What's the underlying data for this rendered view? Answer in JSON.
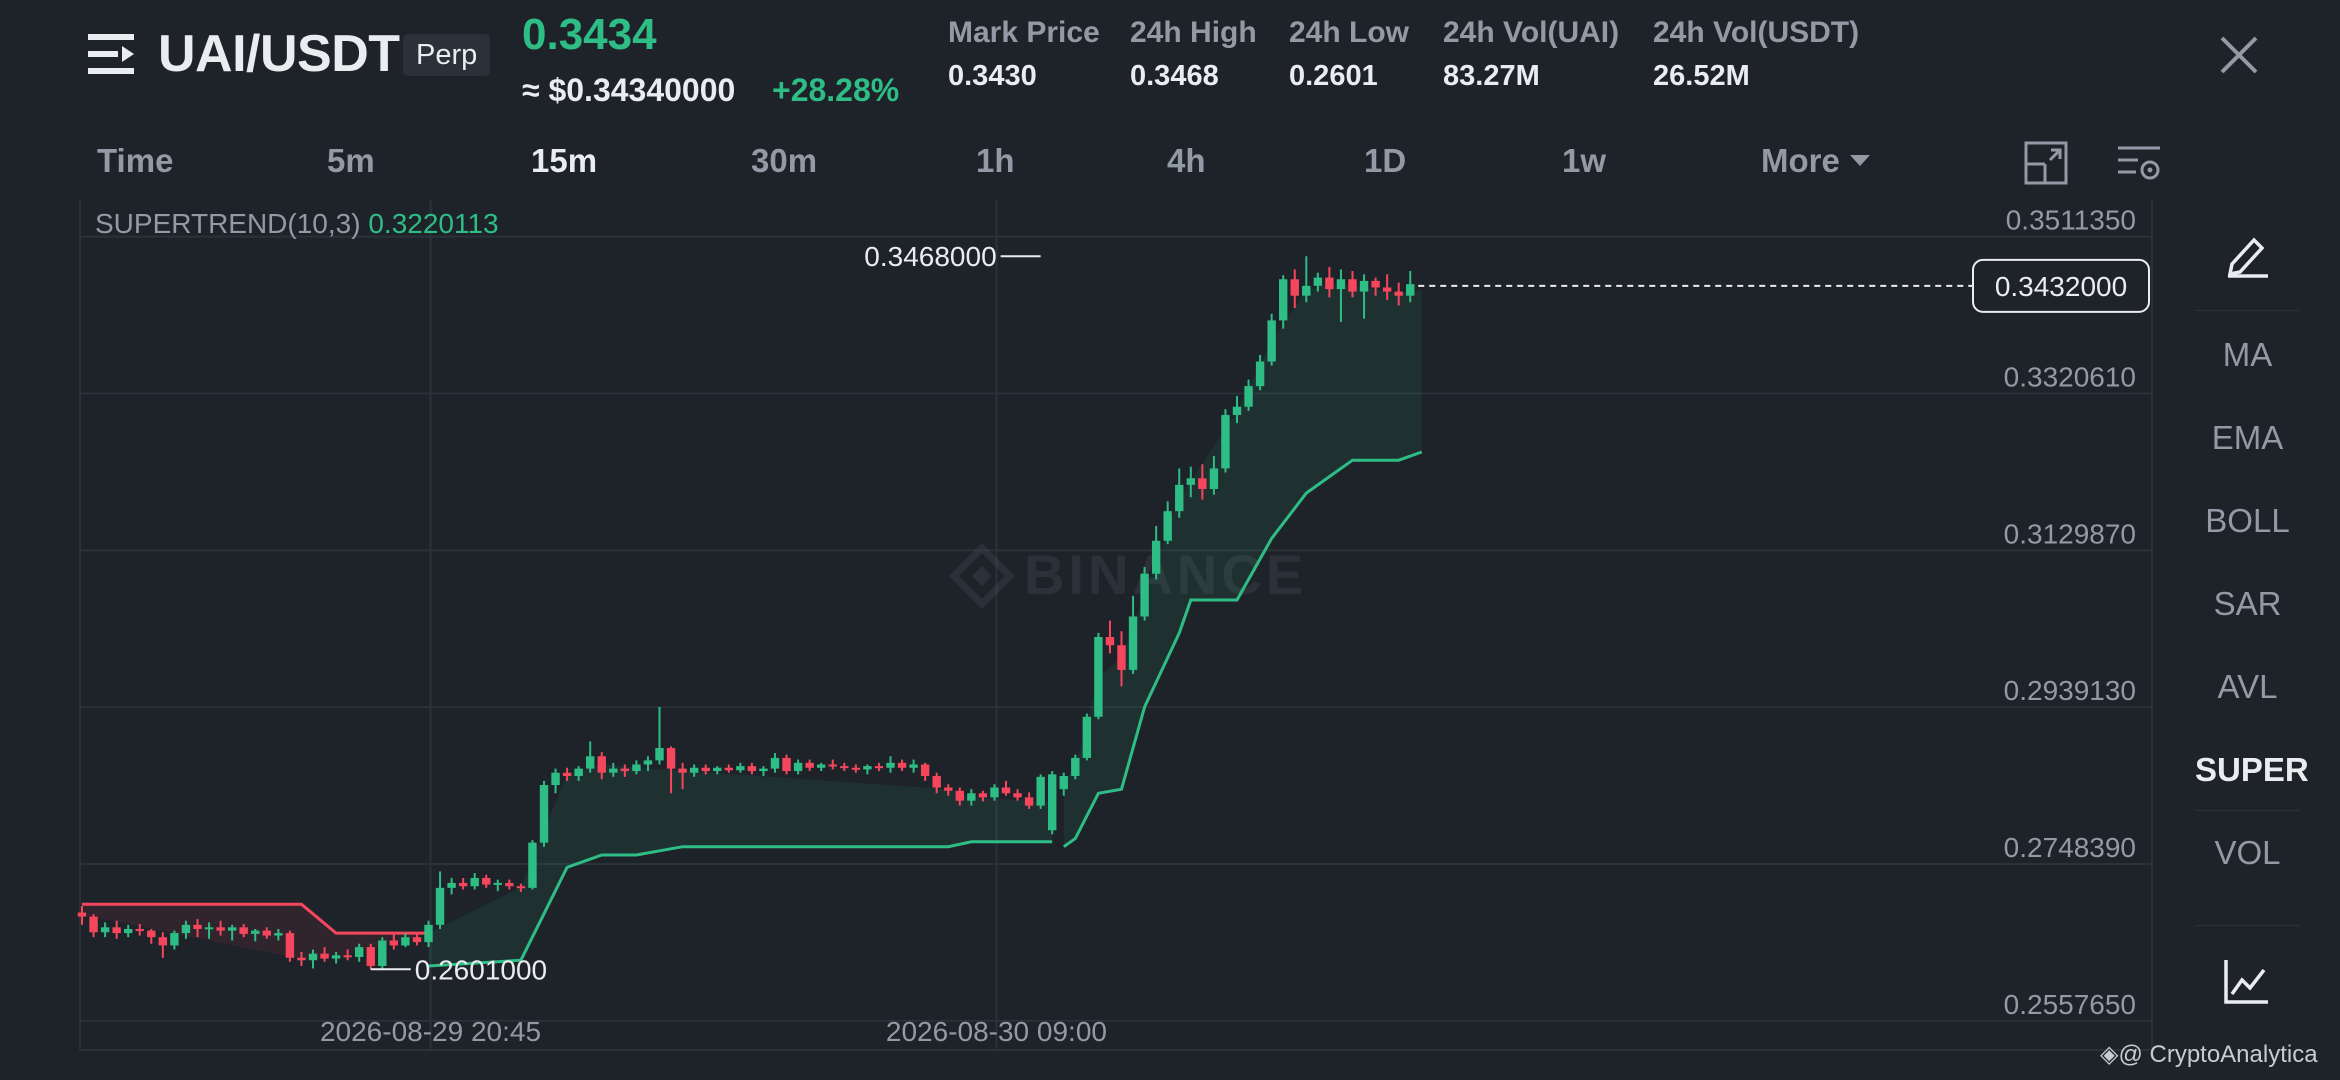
{
  "header": {
    "symbol": "UAI/USDT",
    "contract_type": "Perp",
    "last_price": "0.3434",
    "usd_price": "≈ $0.34340000",
    "change_pct": "+28.28%",
    "stats": [
      {
        "label": "Mark Price",
        "value": "0.3430"
      },
      {
        "label": "24h High",
        "value": "0.3468"
      },
      {
        "label": "24h Low",
        "value": "0.2601"
      },
      {
        "label": "24h Vol(UAI)",
        "value": "83.27M"
      },
      {
        "label": "24h Vol(USDT)",
        "value": "26.52M"
      }
    ]
  },
  "intervals": [
    {
      "label": "Time",
      "active": false
    },
    {
      "label": "5m",
      "active": false
    },
    {
      "label": "15m",
      "active": true
    },
    {
      "label": "30m",
      "active": false
    },
    {
      "label": "1h",
      "active": false
    },
    {
      "label": "4h",
      "active": false
    },
    {
      "label": "1D",
      "active": false
    },
    {
      "label": "1w",
      "active": false
    },
    {
      "label": "More",
      "active": false
    }
  ],
  "indicators": [
    {
      "label": "MA",
      "active": false
    },
    {
      "label": "EMA",
      "active": false
    },
    {
      "label": "BOLL",
      "active": false
    },
    {
      "label": "SAR",
      "active": false
    },
    {
      "label": "AVL",
      "active": false
    },
    {
      "label": "SUPER",
      "active": true
    },
    {
      "label": "VOL",
      "active": false
    }
  ],
  "icons": {
    "menu": "menu-icon",
    "close": "close-icon",
    "draw": "pencil-icon",
    "fullscreen": "fullscreen-icon",
    "settings": "chart-settings-icon",
    "chart_type": "line-chart-icon"
  },
  "colors": {
    "bg": "#1e2329",
    "up": "#2ebd85",
    "down": "#f6465d",
    "grid": "#2b3139",
    "text_muted": "#929aa5"
  },
  "supertrend": {
    "label": "SUPERTREND(10,3)",
    "value": "0.3220113"
  },
  "watermark": "◈@ CryptoAnalytica",
  "chart_data": {
    "type": "candlestick",
    "y_ticks": [
      "0.3511350",
      "0.3320610",
      "0.3129870",
      "0.2939130",
      "0.2748390",
      "0.2557650"
    ],
    "ylim": [
      0.2515,
      0.3585
    ],
    "x_ticks": [
      {
        "label": "2026-08-29 20:45",
        "index": 30
      },
      {
        "label": "2026-08-30 09:00",
        "index": 79
      }
    ],
    "current_price_label": "0.3432000",
    "current_price": 0.3432,
    "high_marker": {
      "label": "0.3468000",
      "index": 83,
      "value": 0.3468
    },
    "low_marker": {
      "label": "0.2601000",
      "index": 25,
      "value": 0.2601
    },
    "candles": [
      [
        0.267,
        0.2678,
        0.2655,
        0.2665
      ],
      [
        0.2665,
        0.2668,
        0.264,
        0.2646
      ],
      [
        0.2646,
        0.2658,
        0.264,
        0.2652
      ],
      [
        0.2652,
        0.266,
        0.2638,
        0.2645
      ],
      [
        0.2645,
        0.2655,
        0.264,
        0.265
      ],
      [
        0.265,
        0.2656,
        0.2642,
        0.2648
      ],
      [
        0.2648,
        0.265,
        0.2632,
        0.264
      ],
      [
        0.264,
        0.2646,
        0.2615,
        0.263
      ],
      [
        0.263,
        0.2648,
        0.2625,
        0.2645
      ],
      [
        0.2645,
        0.266,
        0.2638,
        0.2655
      ],
      [
        0.2655,
        0.2662,
        0.264,
        0.265
      ],
      [
        0.265,
        0.2658,
        0.2638,
        0.2652
      ],
      [
        0.2652,
        0.266,
        0.2642,
        0.2648
      ],
      [
        0.2648,
        0.2655,
        0.2636,
        0.2652
      ],
      [
        0.2652,
        0.2656,
        0.264,
        0.2644
      ],
      [
        0.2644,
        0.265,
        0.2635,
        0.2648
      ],
      [
        0.2648,
        0.2652,
        0.2638,
        0.2642
      ],
      [
        0.2642,
        0.265,
        0.2636,
        0.2645
      ],
      [
        0.2645,
        0.2648,
        0.261,
        0.2615
      ],
      [
        0.2615,
        0.2622,
        0.2605,
        0.2612
      ],
      [
        0.2612,
        0.2625,
        0.2602,
        0.262
      ],
      [
        0.262,
        0.2628,
        0.261,
        0.2614
      ],
      [
        0.2614,
        0.2622,
        0.2608,
        0.2618
      ],
      [
        0.2618,
        0.2625,
        0.2612,
        0.2616
      ],
      [
        0.2616,
        0.2632,
        0.261,
        0.2628
      ],
      [
        0.2628,
        0.2632,
        0.2601,
        0.2605
      ],
      [
        0.2605,
        0.264,
        0.2602,
        0.2636
      ],
      [
        0.2636,
        0.2645,
        0.2625,
        0.263
      ],
      [
        0.263,
        0.2645,
        0.2628,
        0.264
      ],
      [
        0.264,
        0.2646,
        0.263,
        0.2634
      ],
      [
        0.2634,
        0.266,
        0.2628,
        0.2655
      ],
      [
        0.2655,
        0.272,
        0.265,
        0.27
      ],
      [
        0.27,
        0.2712,
        0.2692,
        0.2706
      ],
      [
        0.2706,
        0.2712,
        0.2698,
        0.2702
      ],
      [
        0.2702,
        0.2718,
        0.2698,
        0.2712
      ],
      [
        0.2712,
        0.2716,
        0.27,
        0.2704
      ],
      [
        0.2704,
        0.271,
        0.2696,
        0.2706
      ],
      [
        0.2706,
        0.271,
        0.2698,
        0.2702
      ],
      [
        0.2702,
        0.2705,
        0.2695,
        0.27
      ],
      [
        0.27,
        0.2758,
        0.2698,
        0.2755
      ],
      [
        0.2755,
        0.283,
        0.275,
        0.2825
      ],
      [
        0.2825,
        0.2845,
        0.2815,
        0.284
      ],
      [
        0.284,
        0.2846,
        0.283,
        0.2836
      ],
      [
        0.2836,
        0.2848,
        0.283,
        0.2845
      ],
      [
        0.2845,
        0.2878,
        0.284,
        0.286
      ],
      [
        0.286,
        0.2865,
        0.2832,
        0.284
      ],
      [
        0.284,
        0.2852,
        0.2835,
        0.2845
      ],
      [
        0.2845,
        0.285,
        0.2835,
        0.2842
      ],
      [
        0.2842,
        0.2855,
        0.2838,
        0.285
      ],
      [
        0.285,
        0.286,
        0.2842,
        0.2855
      ],
      [
        0.2855,
        0.292,
        0.285,
        0.287
      ],
      [
        0.287,
        0.2872,
        0.2815,
        0.2845
      ],
      [
        0.2845,
        0.2852,
        0.282,
        0.284
      ],
      [
        0.284,
        0.285,
        0.2835,
        0.2846
      ],
      [
        0.2846,
        0.285,
        0.2838,
        0.2842
      ],
      [
        0.2842,
        0.2848,
        0.2838,
        0.2846
      ],
      [
        0.2846,
        0.285,
        0.284,
        0.2843
      ],
      [
        0.2843,
        0.2852,
        0.284,
        0.2848
      ],
      [
        0.2848,
        0.2852,
        0.2838,
        0.2842
      ],
      [
        0.2842,
        0.2848,
        0.2836,
        0.2845
      ],
      [
        0.2845,
        0.2864,
        0.284,
        0.2858
      ],
      [
        0.2858,
        0.2862,
        0.2838,
        0.2842
      ],
      [
        0.2842,
        0.2856,
        0.2838,
        0.2852
      ],
      [
        0.2852,
        0.2856,
        0.2842,
        0.2846
      ],
      [
        0.2846,
        0.2852,
        0.2842,
        0.285
      ],
      [
        0.285,
        0.2856,
        0.2844,
        0.2848
      ],
      [
        0.2848,
        0.2852,
        0.2842,
        0.2846
      ],
      [
        0.2846,
        0.285,
        0.284,
        0.2844
      ],
      [
        0.2844,
        0.285,
        0.2838,
        0.2848
      ],
      [
        0.2848,
        0.2852,
        0.2842,
        0.2846
      ],
      [
        0.2846,
        0.286,
        0.284,
        0.2852
      ],
      [
        0.2852,
        0.2856,
        0.2842,
        0.2846
      ],
      [
        0.2846,
        0.2856,
        0.284,
        0.285
      ],
      [
        0.285,
        0.2852,
        0.283,
        0.2836
      ],
      [
        0.2836,
        0.284,
        0.2815,
        0.2822
      ],
      [
        0.2822,
        0.2826,
        0.2812,
        0.2818
      ],
      [
        0.2818,
        0.2822,
        0.28,
        0.2806
      ],
      [
        0.2806,
        0.282,
        0.28,
        0.2815
      ],
      [
        0.2815,
        0.2818,
        0.2805,
        0.281
      ],
      [
        0.281,
        0.2826,
        0.2806,
        0.2822
      ],
      [
        0.2822,
        0.283,
        0.2812,
        0.2815
      ],
      [
        0.2815,
        0.282,
        0.2806,
        0.281
      ],
      [
        0.281,
        0.2816,
        0.2796,
        0.28
      ],
      [
        0.28,
        0.2838,
        0.2796,
        0.2835
      ]
    ],
    "candles_tail": [
      [
        0.277,
        0.2842,
        0.2765,
        0.2838
      ],
      [
        0.282,
        0.284,
        0.2812,
        0.2836
      ],
      [
        0.2836,
        0.2862,
        0.2832,
        0.2858
      ],
      [
        0.2858,
        0.2912,
        0.2855,
        0.2908
      ],
      [
        0.2908,
        0.301,
        0.2905,
        0.3005
      ],
      [
        0.3005,
        0.3025,
        0.2985,
        0.2995
      ],
      [
        0.2995,
        0.3012,
        0.2945,
        0.2965
      ],
      [
        0.2965,
        0.3055,
        0.296,
        0.303
      ],
      [
        0.303,
        0.309,
        0.3025,
        0.3082
      ],
      [
        0.3082,
        0.314,
        0.3075,
        0.3122
      ],
      [
        0.3122,
        0.317,
        0.3118,
        0.3158
      ],
      [
        0.3158,
        0.321,
        0.315,
        0.319
      ],
      [
        0.319,
        0.3212,
        0.3175,
        0.3198
      ],
      [
        0.3198,
        0.3215,
        0.3172,
        0.3185
      ],
      [
        0.3185,
        0.3225,
        0.3178,
        0.321
      ],
      [
        0.321,
        0.3282,
        0.3205,
        0.3275
      ],
      [
        0.3275,
        0.3298,
        0.3265,
        0.3285
      ],
      [
        0.3285,
        0.3318,
        0.328,
        0.331
      ],
      [
        0.331,
        0.3348,
        0.3305,
        0.334
      ],
      [
        0.334,
        0.3398,
        0.3335,
        0.339
      ],
      [
        0.339,
        0.3445,
        0.338,
        0.344
      ],
      [
        0.344,
        0.3452,
        0.3405,
        0.342
      ],
      [
        0.342,
        0.3468,
        0.3412,
        0.3432
      ],
      [
        0.3432,
        0.3448,
        0.3425,
        0.3442
      ],
      [
        0.3442,
        0.3455,
        0.3418,
        0.3428
      ],
      [
        0.3428,
        0.3452,
        0.3388,
        0.344
      ],
      [
        0.344,
        0.345,
        0.3418,
        0.3425
      ],
      [
        0.3425,
        0.3446,
        0.3392,
        0.3438
      ],
      [
        0.3438,
        0.3442,
        0.342,
        0.343
      ],
      [
        0.343,
        0.3446,
        0.3415,
        0.3425
      ],
      [
        0.3425,
        0.3436,
        0.3408,
        0.342
      ],
      [
        0.342,
        0.345,
        0.3412,
        0.3434
      ]
    ],
    "supertrend_down": [
      [
        0,
        0.268
      ],
      [
        19,
        0.268
      ],
      [
        22,
        0.2645
      ],
      [
        30,
        0.2645
      ]
    ],
    "supertrend_up": [
      [
        30,
        0.2605
      ],
      [
        38,
        0.2612
      ],
      [
        42,
        0.2725
      ],
      [
        45,
        0.274
      ],
      [
        48,
        0.274
      ],
      [
        52,
        0.275
      ],
      [
        75,
        0.275
      ],
      [
        77,
        0.2756
      ],
      [
        84,
        0.2756
      ]
    ],
    "supertrend_up2": [
      [
        85,
        0.275
      ],
      [
        86,
        0.276
      ],
      [
        88,
        0.2815
      ],
      [
        90,
        0.282
      ],
      [
        92,
        0.292
      ],
      [
        95,
        0.301
      ],
      [
        96,
        0.305
      ],
      [
        100,
        0.305
      ],
      [
        103,
        0.3125
      ],
      [
        106,
        0.318
      ],
      [
        108,
        0.32
      ],
      [
        110,
        0.322
      ],
      [
        114,
        0.322
      ],
      [
        116,
        0.323
      ]
    ]
  }
}
